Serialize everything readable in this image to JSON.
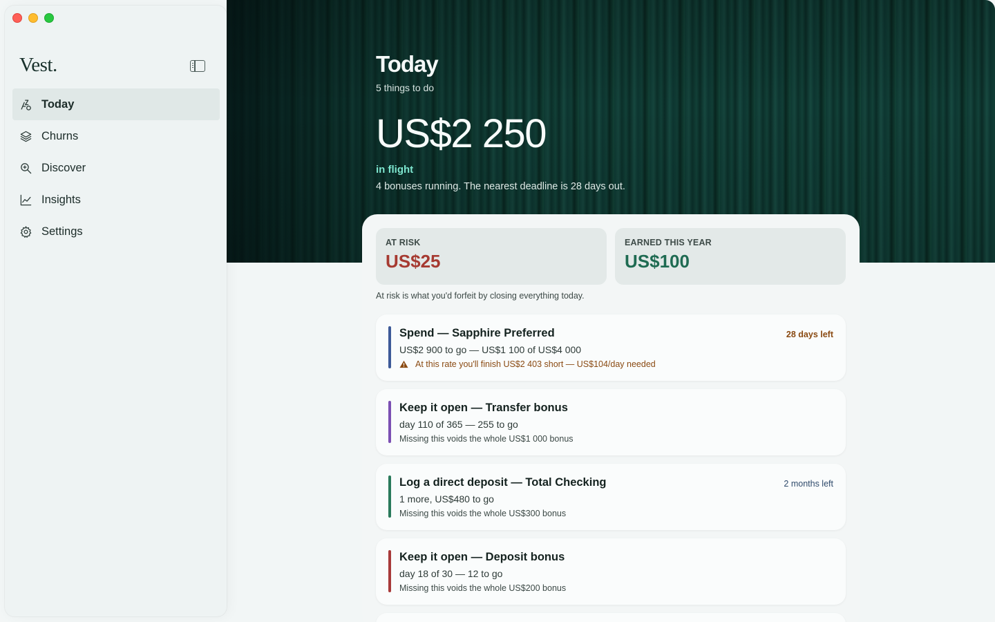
{
  "app": {
    "brand": "Vest."
  },
  "sidebar": {
    "items": [
      {
        "label": "Today",
        "icon": "today-icon",
        "active": true
      },
      {
        "label": "Churns",
        "icon": "layers-icon",
        "active": false
      },
      {
        "label": "Discover",
        "icon": "search-icon",
        "active": false
      },
      {
        "label": "Insights",
        "icon": "chart-icon",
        "active": false
      },
      {
        "label": "Settings",
        "icon": "gear-icon",
        "active": false
      }
    ]
  },
  "hero": {
    "title": "Today",
    "subtitle": "5 things to do",
    "amount": "US$2 250",
    "status": "in flight",
    "description": "4 bonuses running. The nearest deadline is 28 days out."
  },
  "stats": {
    "at_risk": {
      "label": "AT RISK",
      "value": "US$25",
      "color": "#a63a31"
    },
    "earned": {
      "label": "EARNED THIS YEAR",
      "value": "US$100",
      "color": "#1f6b52"
    },
    "note": "At risk is what you'd forfeit by closing everything today."
  },
  "tasks": [
    {
      "title": "Spend — Sapphire Preferred",
      "progress": "US$2 900 to go — US$1 100 of US$4 000",
      "note": "At this rate you'll finish US$2 403 short — US$104/day needed",
      "deadline": "28 days left",
      "accent": "#3d5a98"
    },
    {
      "title": "Keep it open — Transfer bonus",
      "progress": "day 110 of 365 — 255 to go",
      "note": "Missing this voids the whole US$1 000 bonus",
      "deadline": "",
      "accent": "#7b4fb3"
    },
    {
      "title": "Log a direct deposit — Total Checking",
      "progress": "1 more, US$480 to go",
      "note": "Missing this voids the whole US$300 bonus",
      "deadline": "2 months left",
      "accent": "#2a7a5b"
    },
    {
      "title": "Keep it open — Deposit bonus",
      "progress": "day 18 of 30 — 12 to go",
      "note": "Missing this voids the whole US$200 bonus",
      "deadline": "",
      "accent": "#a83a3a"
    }
  ]
}
